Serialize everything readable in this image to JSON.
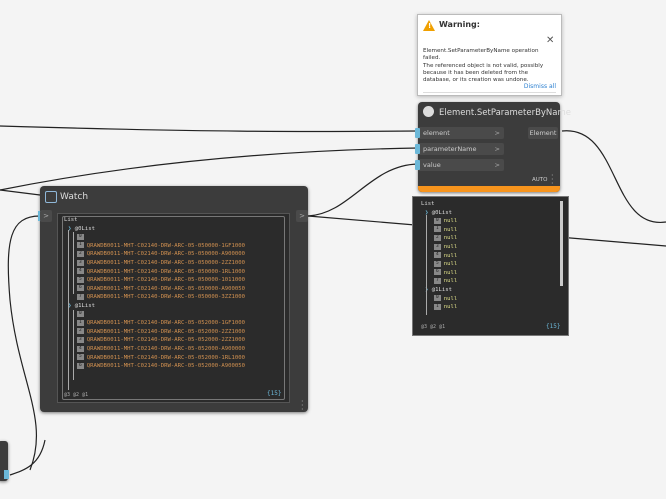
{
  "warning": {
    "title": "Warning:",
    "message_line1": "Element.SetParameterByName operation failed.",
    "message_line2": "The referenced object is not valid, possibly because it has been deleted from the database, or its creation was undone.",
    "dismiss": "Dismiss all",
    "color": "#f0a000"
  },
  "set_param_node": {
    "title": "Element.SetParameterByName",
    "inputs": [
      "element",
      "parameterName",
      "value"
    ],
    "output": "Element",
    "lacing": "AUTO",
    "warning_bar_color": "#f7941d"
  },
  "watch_node": {
    "title": "Watch",
    "input_chevron": ">",
    "output_chevron": ">",
    "root_label": "List",
    "lists": [
      {
        "index": "@0",
        "label": "List",
        "items": [
          {
            "idx": "0",
            "value": ""
          },
          {
            "idx": "1",
            "value": "QRAWDB0011-MHT-C02140-DRW-ARC-05-050000-1GF1000"
          },
          {
            "idx": "2",
            "value": "QRAWDB0011-MHT-C02140-DRW-ARC-05-050000-A900000"
          },
          {
            "idx": "3",
            "value": "QRAWDB0011-MHT-C02140-DRW-ARC-05-050000-2ZZ1000"
          },
          {
            "idx": "4",
            "value": "QRAWDB0011-MHT-C02140-DRW-ARC-05-050000-1RL1000"
          },
          {
            "idx": "5",
            "value": "QRAWDB0011-MHT-C02140-DRW-ARC-05-050000-1011000"
          },
          {
            "idx": "6",
            "value": "QRAWDB0011-MHT-C02140-DRW-ARC-05-050000-A900050"
          },
          {
            "idx": "7",
            "value": "QRAWDB0011-MHT-C02140-DRW-ARC-05-050000-3ZZ1000"
          }
        ]
      },
      {
        "index": "@1",
        "label": "List",
        "items": [
          {
            "idx": "0",
            "value": ""
          },
          {
            "idx": "1",
            "value": "QRAWDB0011-MHT-C02140-DRW-ARC-05-052000-1GF1000"
          },
          {
            "idx": "2",
            "value": "QRAWDB0011-MHT-C02140-DRW-ARC-05-052000-2ZZ1000"
          },
          {
            "idx": "3",
            "value": "QRAWDB0011-MHT-C02140-DRW-ARC-05-052000-2ZZ1000"
          },
          {
            "idx": "4",
            "value": "QRAWDB0011-MHT-C02140-DRW-ARC-05-052000-A900000"
          },
          {
            "idx": "5",
            "value": "QRAWDB0011-MHT-C02140-DRW-ARC-05-052000-1RL1000"
          },
          {
            "idx": "6",
            "value": "QRAWDB0011-MHT-C02140-DRW-ARC-05-052000-A900050"
          }
        ]
      }
    ],
    "levels": "@3 @2 @1",
    "count": "{15}"
  },
  "preview": {
    "root_label": "List",
    "list0": {
      "index": "@0",
      "label": "List"
    },
    "items": [
      {
        "idx": "0",
        "value": "null"
      },
      {
        "idx": "1",
        "value": "null"
      },
      {
        "idx": "2",
        "value": "null"
      },
      {
        "idx": "3",
        "value": "null"
      },
      {
        "idx": "4",
        "value": "null"
      },
      {
        "idx": "5",
        "value": "null"
      },
      {
        "idx": "6",
        "value": "null"
      },
      {
        "idx": "7",
        "value": "null"
      }
    ],
    "list1": {
      "index": "@1",
      "label": "List"
    },
    "items2": [
      {
        "idx": "0",
        "value": "null"
      },
      {
        "idx": "1",
        "value": "null"
      }
    ],
    "levels": "@3 @2 @1",
    "count": "{15}"
  }
}
